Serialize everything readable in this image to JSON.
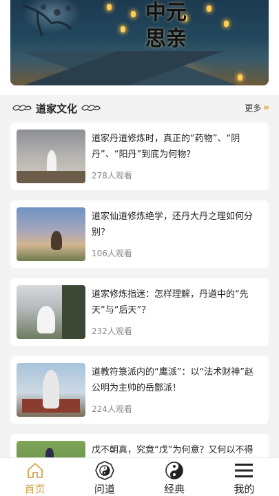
{
  "banner": {
    "title": "中元思亲"
  },
  "section": {
    "title": "道家文化",
    "more_label": "更多"
  },
  "articles": [
    {
      "title": "道家丹道修炼时，真正的“药物”、“阴丹”、“阳丹”到底为何物？",
      "views": "278人观看"
    },
    {
      "title": "道家仙道修炼绝学，还丹大丹之理如何分别？",
      "views": "106人观看"
    },
    {
      "title": "道家修炼指迷：怎样理解，丹道中的“先天”与“后天”？",
      "views": "232人观看"
    },
    {
      "title": "道教符箓派内的“鹰派”：以“法术财神”赵公明为主帅的岳鄷派！",
      "views": "224人观看"
    },
    {
      "title": "戊不朝真，究竟“戊”为何意？又何以不得",
      "views": ""
    }
  ],
  "tabbar": [
    {
      "label": "首页",
      "icon": "home-icon",
      "active": true
    },
    {
      "label": "问道",
      "icon": "bagua-icon",
      "active": false
    },
    {
      "label": "经典",
      "icon": "taiji-icon",
      "active": false
    },
    {
      "label": "我的",
      "icon": "menu-icon",
      "active": false
    }
  ],
  "colors": {
    "accent": "#d4a24a",
    "more_arrow": "#e8a200",
    "background": "#f3f3f3"
  }
}
